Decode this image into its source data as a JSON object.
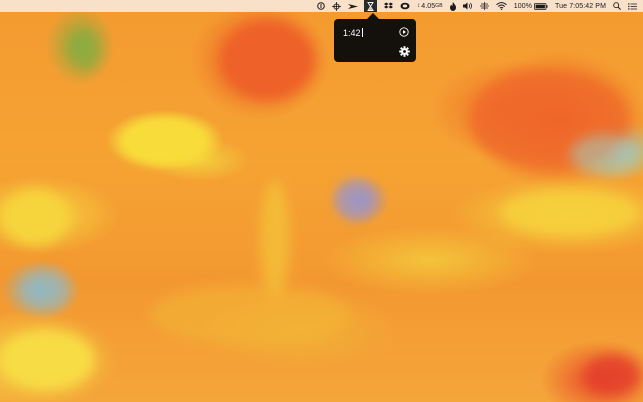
{
  "menubar": {
    "icons": [
      "onepassword-icon",
      "crosshair-icon",
      "vpn-wedge-icon",
      "hourglass-timer-icon",
      "dropbox-icon",
      "cloud-icon",
      "flame-icon",
      "volume-icon",
      "network-icon",
      "wifi-icon",
      "battery-icon",
      "search-icon",
      "notification-center-icon"
    ],
    "memory_value": "4.05",
    "memory_unit": "GB",
    "battery_percent": "100%",
    "clock": "Tue 7:05:42 PM"
  },
  "timer_popover": {
    "input_value": "1:42",
    "play_icon": "play-circle-icon",
    "settings_icon": "gear-icon"
  },
  "colors": {
    "menubar_bg": "#f8e6d7",
    "popover_bg": "#0a0a0a",
    "wallpaper_base": "#f39a2e",
    "wallpaper_yellow": "#f7d53a",
    "wallpaper_red": "#ec5a25"
  }
}
